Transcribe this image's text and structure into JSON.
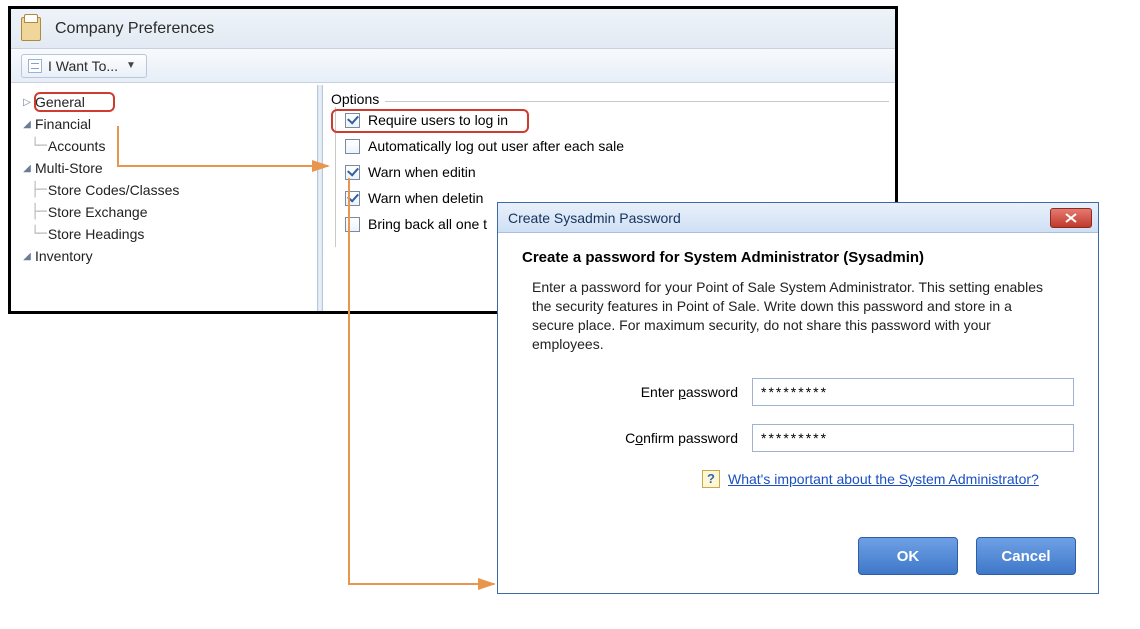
{
  "window": {
    "title": "Company Preferences",
    "i_want_to": "I Want To..."
  },
  "tree": {
    "general": "General",
    "financial": "Financial",
    "accounts": "Accounts",
    "multi_store": "Multi-Store",
    "store_codes": "Store Codes/Classes",
    "store_exchange": "Store Exchange",
    "store_headings": "Store Headings",
    "inventory": "Inventory"
  },
  "options": {
    "legend": "Options",
    "require_login": {
      "label": "Require users to log in",
      "checked": true
    },
    "auto_logout": {
      "label": "Automatically log out user after each sale",
      "checked": false
    },
    "warn_edit": {
      "label": "Warn when editin",
      "checked": true
    },
    "warn_delete": {
      "label": "Warn when deletin",
      "checked": true
    },
    "bring_back": {
      "label": "Bring back all one t",
      "checked": false
    }
  },
  "dialog": {
    "title": "Create Sysadmin Password",
    "heading": "Create a password for System Administrator (Sysadmin)",
    "body": "Enter a password for your Point of Sale System Administrator. This setting enables the security features in Point of Sale.  Write down this password and store in a secure place. For maximum security, do not share this password with your employees.",
    "enter_label_pre": "Enter ",
    "enter_label_u": "p",
    "enter_label_post": "assword",
    "confirm_label_pre": "C",
    "confirm_label_u": "o",
    "confirm_label_post": "nfirm password",
    "enter_value": "*********",
    "confirm_value": "*********",
    "help_link": "What's important about the System Administrator?",
    "ok": "OK",
    "cancel": "Cancel"
  }
}
